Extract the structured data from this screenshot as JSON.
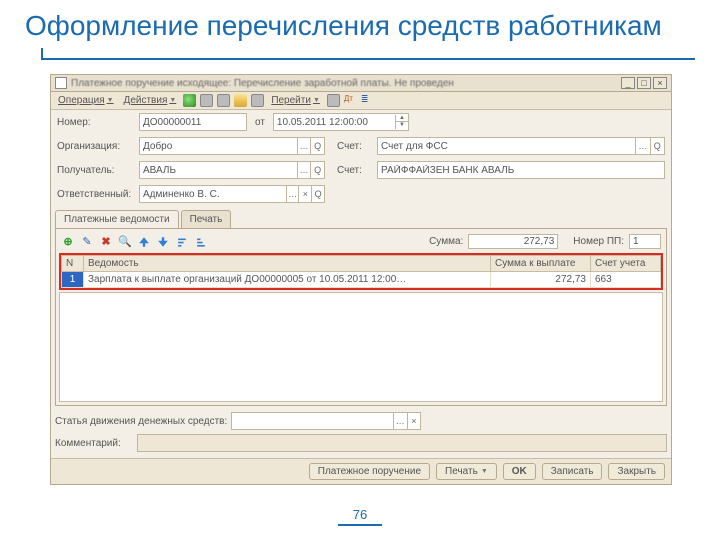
{
  "slide": {
    "title": "Оформление перечисления средств работникам",
    "page": "76"
  },
  "win": {
    "title": "Платежное поручение исходящее: Перечисление заработной платы. Не проведен",
    "min": "_",
    "restore": "□",
    "close": "×"
  },
  "toolbar": {
    "operation": "Операция",
    "actions": "Действия",
    "goto": "Перейти"
  },
  "form": {
    "number_lbl": "Номер:",
    "number": "ДО00000011",
    "from": "от",
    "date": "10.05.2011 12:00:00",
    "org_lbl": "Организация:",
    "org": "Добро",
    "acc_lbl": "Счет:",
    "acc": "Счет для ФСС",
    "recv_lbl": "Получатель:",
    "recv": "АВАЛЬ",
    "bank_lbl": "Счет:",
    "bank": "РАЙФФАЙЗЕН БАНК АВАЛЬ",
    "resp_lbl": "Ответственный:",
    "resp": "Админенко В. С."
  },
  "tabs": {
    "t1": "Платежные ведомости",
    "t2": "Печать"
  },
  "grid": {
    "sum_lbl": "Сумма:",
    "sum": "272,73",
    "npp_lbl": "Номер ПП:",
    "npp": "1",
    "cols": {
      "n": "N",
      "ved": "Ведомость",
      "sumk": "Сумма к выплате",
      "acct": "Счет учета"
    },
    "row": {
      "n": "1",
      "ved": "Зарплата к выплате организаций ДО00000005 от 10.05.2011 12:00…",
      "sumk": "272,73",
      "acct": "663"
    }
  },
  "bottom": {
    "cashflow_lbl": "Статья движения денежных средств:",
    "comment_lbl": "Комментарий:"
  },
  "footer": {
    "pp": "Платежное поручение",
    "print": "Печать",
    "ok": "OK",
    "save": "Записать",
    "close": "Закрыть"
  }
}
